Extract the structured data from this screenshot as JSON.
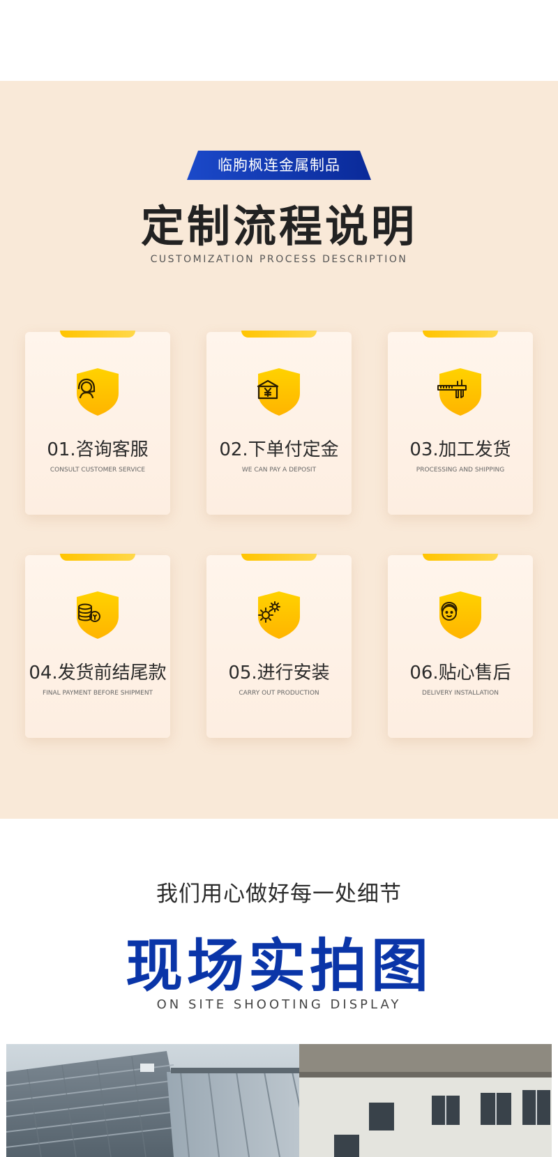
{
  "header": {
    "ribbon_label": "临朐枫连金属制品"
  },
  "process": {
    "title": "定制流程说明",
    "subtitle": "CUSTOMIZATION PROCESS DESCRIPTION",
    "accent_color": "#ffc400",
    "steps": [
      {
        "title": "01.咨询客服",
        "subtitle": "CONSULT CUSTOMER SERVICE",
        "icon": "headset-icon"
      },
      {
        "title": "02.下单付定金",
        "subtitle": "WE CAN PAY A DEPOSIT",
        "icon": "yen-box-icon"
      },
      {
        "title": "03.加工发货",
        "subtitle": "PROCESSING AND SHIPPING",
        "icon": "caliper-icon"
      },
      {
        "title": "04.发货前结尾款",
        "subtitle": "FINAL PAYMENT BEFORE SHIPMENT",
        "icon": "coins-icon"
      },
      {
        "title": "05.进行安装",
        "subtitle": "CARRY OUT PRODUCTION",
        "icon": "gears-icon"
      },
      {
        "title": "06.贴心售后",
        "subtitle": "DELIVERY INSTALLATION",
        "icon": "support-agent-icon"
      }
    ]
  },
  "site": {
    "tagline": "我们用心做好每一处细节",
    "title": "现场实拍图",
    "subtitle": "ON SITE SHOOTING DISPLAY",
    "title_color": "#0a35a8"
  }
}
